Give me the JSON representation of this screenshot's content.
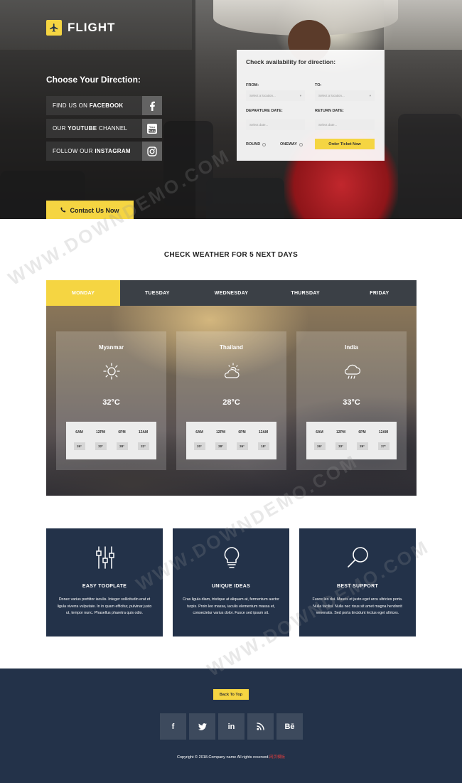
{
  "header": {
    "logo_text": "FLIGHT"
  },
  "hero": {
    "choose_title": "Choose Your Direction:",
    "social": [
      {
        "pre": "FIND US ON ",
        "bold": "FACEBOOK",
        "post": "",
        "icon": "facebook-icon"
      },
      {
        "pre": "OUR ",
        "bold": "YOUTUBE",
        "post": " CHANNEL",
        "icon": "youtube-icon"
      },
      {
        "pre": "FOLLOW OUR ",
        "bold": "INSTAGRAM",
        "post": "",
        "icon": "instagram-icon"
      }
    ],
    "contact_label": "Contact Us Now"
  },
  "booking": {
    "title": "Check availability for direction:",
    "from_label": "FROM:",
    "to_label": "TO:",
    "from_placeholder": "Select a location...",
    "to_placeholder": "Select a location...",
    "departure_label": "DEPARTURE DATE:",
    "return_label": "RETURN DATE:",
    "departure_placeholder": "Select date...",
    "return_placeholder": "Select date...",
    "round_label": "ROUND",
    "oneway_label": "ONEWAY",
    "order_label": "Order Ticket Now"
  },
  "weather": {
    "title": "CHECK WEATHER FOR 5 NEXT DAYS",
    "tabs": [
      "MONDAY",
      "TUESDAY",
      "WEDNESDAY",
      "THURSDAY",
      "FRIDAY"
    ],
    "active_tab": "MONDAY",
    "cards": [
      {
        "city": "Myanmar",
        "icon": "sun-icon",
        "temp": "32°C",
        "hours": [
          "6AM",
          "12PM",
          "6PM",
          "12AM"
        ],
        "temps": [
          "26°",
          "32°",
          "28°",
          "22°"
        ]
      },
      {
        "city": "Thailand",
        "icon": "partly-cloudy-icon",
        "temp": "28°C",
        "hours": [
          "6AM",
          "12PM",
          "6PM",
          "12AM"
        ],
        "temps": [
          "20°",
          "28°",
          "26°",
          "18°"
        ]
      },
      {
        "city": "India",
        "icon": "rain-cloud-icon",
        "temp": "33°C",
        "hours": [
          "6AM",
          "12PM",
          "6PM",
          "12AM"
        ],
        "temps": [
          "26°",
          "33°",
          "29°",
          "27°"
        ]
      }
    ]
  },
  "features": [
    {
      "title": "EASY TOOPLATE",
      "icon": "sliders-icon",
      "text": "Donec varius porttitor iaculis. Integer sollicitudin erat et ligula viverra vulputate. In in quam efficitur, pulvinar justo ut, tempor nunc. Phasellus pharetra quis odio."
    },
    {
      "title": "UNIQUE IDEAS",
      "icon": "lightbulb-icon",
      "text": "Cras ligula diam, tristique at aliquam at, fermentum auctor turpis. Proin leo massa, iaculis elementum massa et, consectetur varius dolor. Fusce sed ipsum sit."
    },
    {
      "title": "BEST SUPPORT",
      "icon": "magnifier-icon",
      "text": "Fusce leo dui. Mauris et justo eget arcu ultricies porta. Nulla facilisi. Nulla nec risus sit amet magna hendrerit venenatis. Sed porta tincidunt lectus eget ultrices."
    }
  ],
  "footer": {
    "back_to_top": "Back To Top",
    "social": [
      {
        "glyph": "f",
        "icon": "facebook-icon"
      },
      {
        "glyph": "t",
        "icon": "twitter-icon"
      },
      {
        "glyph": "in",
        "icon": "linkedin-icon"
      },
      {
        "glyph": "rss",
        "icon": "rss-icon"
      },
      {
        "glyph": "Bē",
        "icon": "behance-icon"
      }
    ],
    "copyright": "Copyright © 2018.Company name All rights reserved.",
    "copyright_brand": "网页模板"
  },
  "watermark": "WWW.DOWNDEMO.COM",
  "colors": {
    "accent": "#f5d542",
    "navy": "#233249",
    "tab_bg": "#3b4046"
  }
}
